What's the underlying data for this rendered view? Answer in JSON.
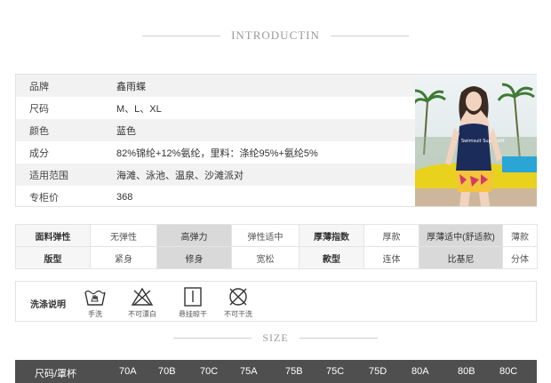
{
  "intro_heading": "INTRODUCTIN",
  "size_heading": "SIZE",
  "product_info": [
    {
      "label": "品牌",
      "value": "鑫雨蝶"
    },
    {
      "label": "尺码",
      "value": "M、L、XL"
    },
    {
      "label": "颜色",
      "value": "蓝色"
    },
    {
      "label": "成分",
      "value": "82%锦纶+12%氨纶，里料：涤纶95%+氨纶5%"
    },
    {
      "label": "适用范围",
      "value": "海滩、泳池、温泉、沙滩派对"
    },
    {
      "label": "专柜价",
      "value": "368"
    }
  ],
  "photo": {
    "icon": "model-photo-swimsuit",
    "shirt_text": "Swimsuit Superlatif"
  },
  "attributes": {
    "row1": {
      "head1": "面料弹性",
      "c1": "无弹性",
      "c2": "高弹力",
      "c3": "弹性适中",
      "head2": "厚薄指数",
      "c4": "厚款",
      "c5": "厚薄适中(舒适款)",
      "c6": "薄款"
    },
    "row2": {
      "head1": "版型",
      "c1": "紧身",
      "c2": "修身",
      "c3": "宽松",
      "head2": "款型",
      "c4": "连体",
      "c5": "比基尼",
      "c6": "分体"
    },
    "selected_color": "#d9d9d9"
  },
  "washing": {
    "title": "洗涤说明",
    "items": [
      {
        "icon": "hand-wash-icon",
        "label": "手洗"
      },
      {
        "icon": "no-bleach-icon",
        "label": "不可漂白"
      },
      {
        "icon": "hang-dry-icon",
        "label": "悬挂晾干"
      },
      {
        "icon": "no-tumble-dry-icon",
        "label": "不可干洗"
      }
    ]
  },
  "size_table": {
    "header": "尺码/罩杯",
    "columns": [
      "70A",
      "70B",
      "70C",
      "75A",
      "75B",
      "75C",
      "75D",
      "80A",
      "80B",
      "80C"
    ]
  }
}
